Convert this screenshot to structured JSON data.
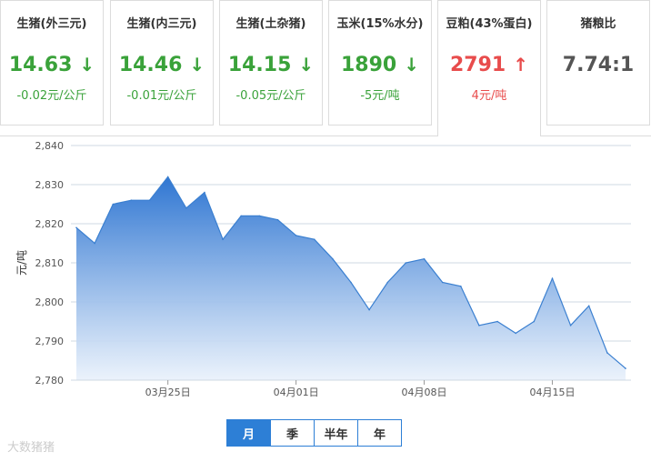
{
  "price_cards": [
    {
      "name": "生猪(外三元)",
      "price": "14.63",
      "arrow": "↓",
      "change": "-0.02元/公斤",
      "trend": "down"
    },
    {
      "name": "生猪(内三元)",
      "price": "14.46",
      "arrow": "↓",
      "change": "-0.01元/公斤",
      "trend": "down"
    },
    {
      "name": "生猪(土杂猪)",
      "price": "14.15",
      "arrow": "↓",
      "change": "-0.05元/公斤",
      "trend": "down"
    },
    {
      "name": "玉米(15%水分)",
      "price": "1890",
      "arrow": "↓",
      "change": "-5元/吨",
      "trend": "down"
    },
    {
      "name": "豆粕(43%蛋白)",
      "price": "2791",
      "arrow": "↑",
      "change": "4元/吨",
      "trend": "up"
    },
    {
      "name": "猪粮比",
      "price": "7.74:1",
      "arrow": "",
      "change": "",
      "trend": "none"
    }
  ],
  "active_card": 4,
  "colors": {
    "up": "#e84c4c",
    "down": "#3aa23a",
    "accent": "#2d7fd6",
    "line": "#3a7fd0"
  },
  "chart_data": {
    "type": "area",
    "xlabel": "",
    "ylabel": "元/吨",
    "ylim": [
      2780,
      2840
    ],
    "yticks": [
      "2,780",
      "2,790",
      "2,800",
      "2,810",
      "2,820",
      "2,830",
      "2,840"
    ],
    "yticks_values": [
      2780,
      2790,
      2800,
      2810,
      2820,
      2830,
      2840
    ],
    "xticks": [
      "03月25日",
      "04月01日",
      "04月08日",
      "04月15日"
    ],
    "xticks_dates": [
      "03-25",
      "04-01",
      "04-08",
      "04-15"
    ],
    "grid": true,
    "dates": [
      "03-20",
      "03-21",
      "03-22",
      "03-23",
      "03-24",
      "03-25",
      "03-26",
      "03-27",
      "03-28",
      "03-29",
      "03-30",
      "03-31",
      "04-01",
      "04-02",
      "04-03",
      "04-04",
      "04-05",
      "04-06",
      "04-07",
      "04-08",
      "04-09",
      "04-10",
      "04-11",
      "04-12",
      "04-13",
      "04-14",
      "04-15",
      "04-16",
      "04-17",
      "04-18",
      "04-19"
    ],
    "series": [
      {
        "values": [
          2819,
          2815,
          2825,
          2826,
          2826,
          2832,
          2824,
          2828,
          2816,
          2822,
          2822,
          2821,
          2817,
          2816,
          2811,
          2805,
          2798,
          2805,
          2810,
          2811,
          2805,
          2804,
          2794,
          2795,
          2792,
          2795,
          2806,
          2794,
          2799,
          2787,
          2783
        ]
      }
    ]
  },
  "periods": [
    "月",
    "季",
    "半年",
    "年"
  ],
  "active_period": "月",
  "watermark": "大数猪猪"
}
